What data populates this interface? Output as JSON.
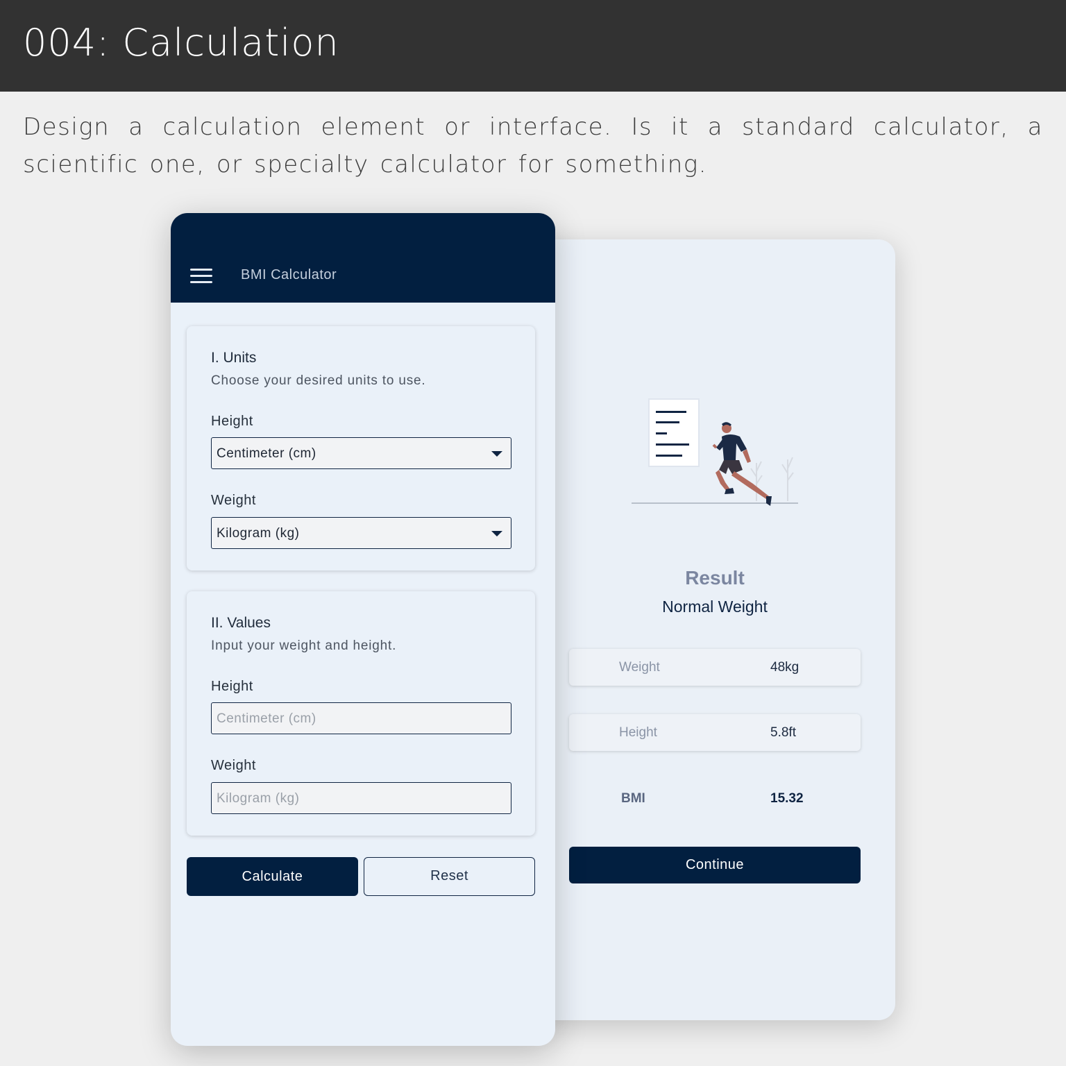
{
  "header": {
    "title": "004: Calculation"
  },
  "description": "Design a calculation element or interface. Is it a standard calculator, a scientific one, or specialty calculator for something.",
  "form_screen": {
    "app_title": "BMI Calculator",
    "units_card": {
      "title": "I. Units",
      "subtitle": "Choose your desired units to use.",
      "height_label": "Height",
      "height_value": "Centimeter (cm)",
      "weight_label": "Weight",
      "weight_value": "Kilogram (kg)"
    },
    "values_card": {
      "title": "II. Values",
      "subtitle": "Input your weight and height.",
      "height_label": "Height",
      "height_placeholder": "Centimeter (cm)",
      "weight_label": "Weight",
      "weight_placeholder": "Kilogram (kg)"
    },
    "calculate_label": "Calculate",
    "reset_label": "Reset"
  },
  "result_screen": {
    "title": "Result",
    "status": "Normal Weight",
    "rows": [
      {
        "label": "Weight",
        "value": "48kg"
      },
      {
        "label": "Height",
        "value": "5.8ft"
      }
    ],
    "bmi_label": "BMI",
    "bmi_value": "15.32",
    "continue_label": "Continue"
  },
  "colors": {
    "navy": "#021f40",
    "header_bg": "#323232",
    "page_bg": "#efefef",
    "card_bg": "#eaf1f9",
    "runner_shirt": "#1b2a45",
    "runner_skin": "#b26b5e"
  }
}
